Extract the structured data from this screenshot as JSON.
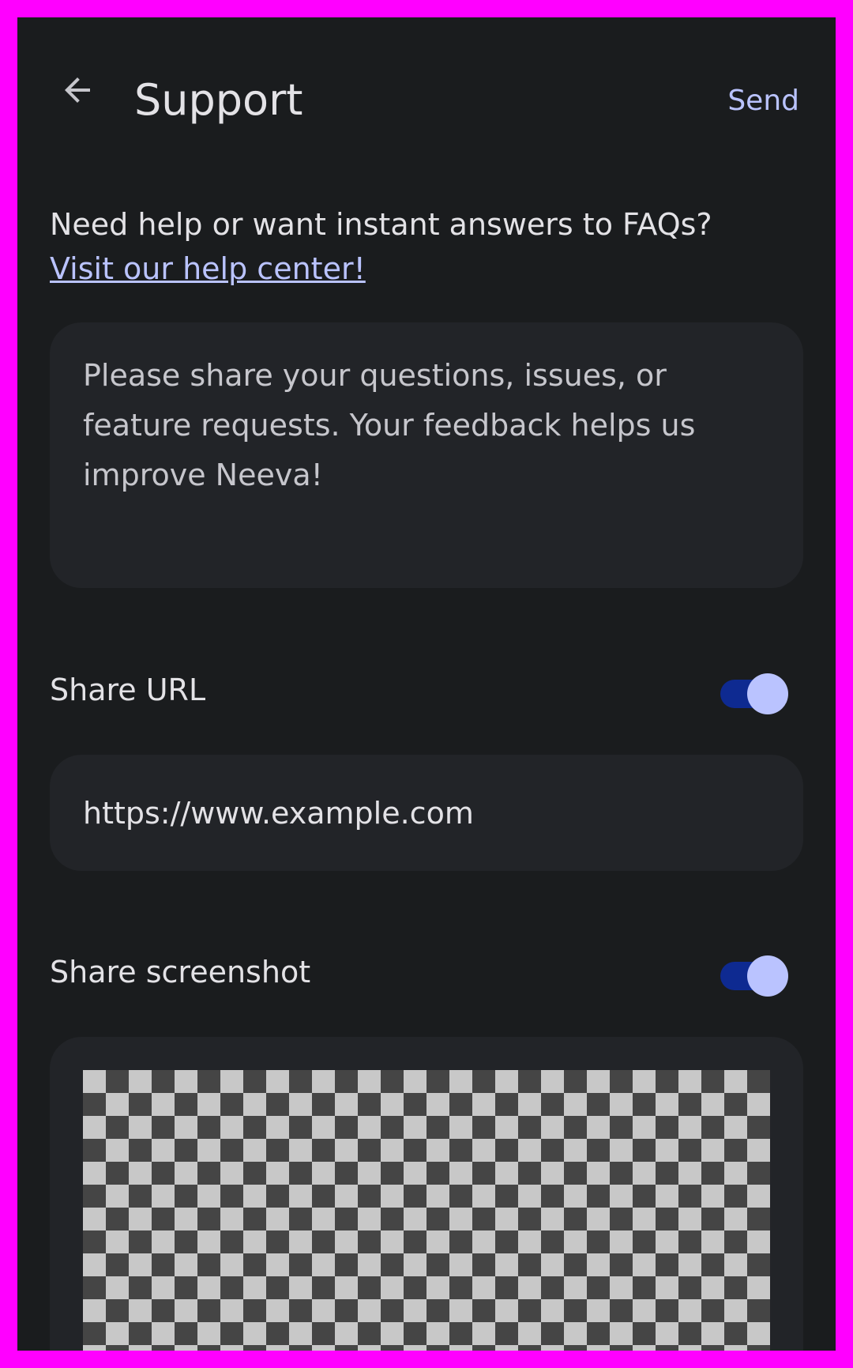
{
  "header": {
    "title": "Support",
    "send_label": "Send",
    "back_icon": "arrow-back-icon"
  },
  "help": {
    "prompt": "Need help or want instant answers to FAQs?",
    "link_label": "Visit our help center!"
  },
  "feedback": {
    "placeholder": "Please share your questions, issues, or feature requests. Your feedback helps us improve Neeva!",
    "value": ""
  },
  "share_url": {
    "label": "Share URL",
    "enabled": true,
    "url": "https://www.example.com"
  },
  "share_screenshot": {
    "label": "Share screenshot",
    "enabled": true
  },
  "colors": {
    "background": "#1a1c1e",
    "surface": "#222428",
    "accent": "#bac3ff",
    "toggle_track": "#0e2a91",
    "frame": "#ff00ff"
  }
}
